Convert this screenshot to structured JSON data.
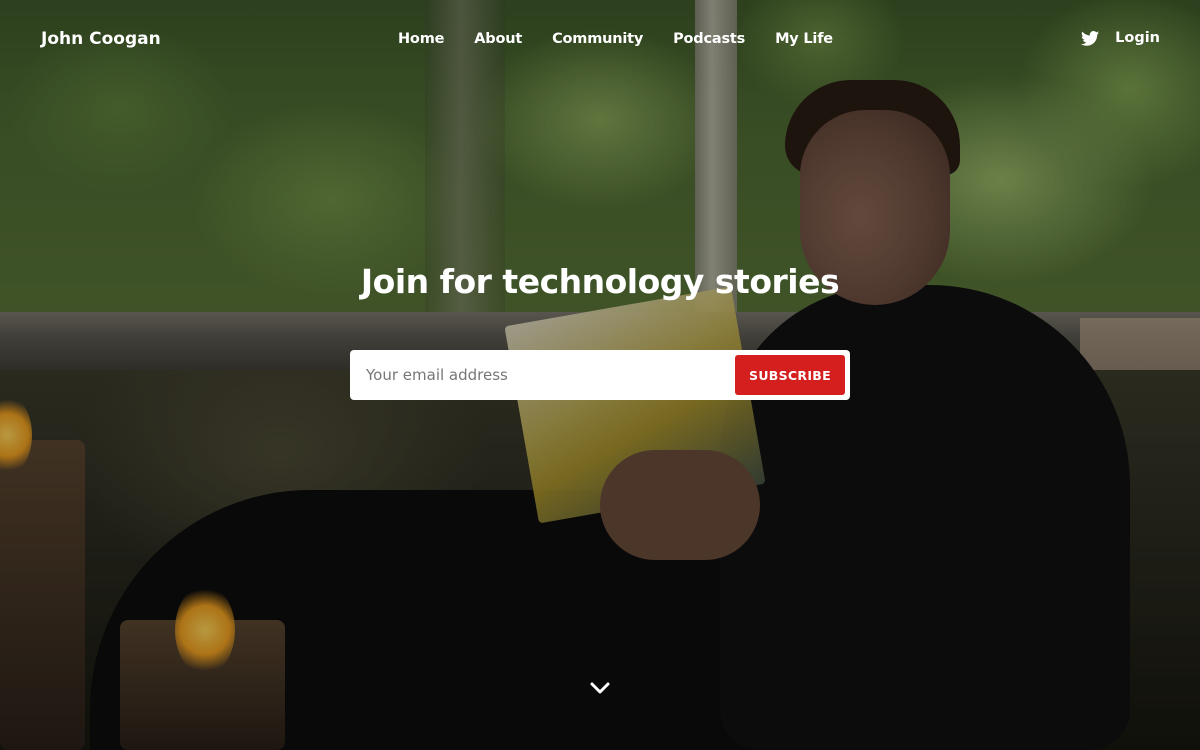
{
  "nav": {
    "brand": "John Coogan",
    "items": [
      {
        "label": "Home"
      },
      {
        "label": "About"
      },
      {
        "label": "Community"
      },
      {
        "label": "Podcasts"
      },
      {
        "label": "My Life"
      }
    ],
    "twitter_icon": "twitter-icon",
    "login_label": "Login"
  },
  "hero": {
    "headline": "Join for technology stories",
    "email_placeholder": "Your email address",
    "subscribe_label": "SUBSCRIBE",
    "scroll_icon": "chevron-down-icon"
  },
  "colors": {
    "accent": "#d51f1f",
    "text": "#ffffff"
  }
}
